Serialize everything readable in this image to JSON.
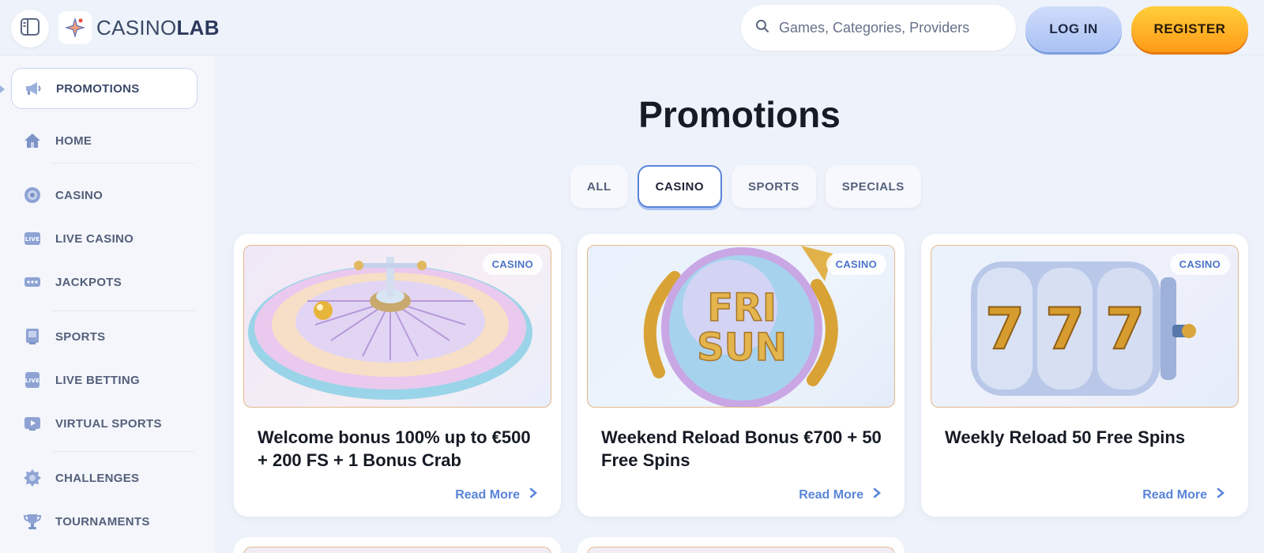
{
  "header": {
    "logo_text_regular": "CASINO",
    "logo_text_bold": "LAB",
    "search_placeholder": "Games, Categories, Providers",
    "login_label": "LOG IN",
    "register_label": "REGISTER"
  },
  "sidebar": {
    "items": [
      {
        "label": "PROMOTIONS",
        "icon": "megaphone-icon",
        "active": true
      },
      {
        "label": "HOME",
        "icon": "home-icon"
      },
      {
        "label": "CASINO",
        "icon": "casino-chip-icon"
      },
      {
        "label": "LIVE CASINO",
        "icon": "live-casino-icon"
      },
      {
        "label": "JACKPOTS",
        "icon": "jackpot-icon"
      },
      {
        "label": "SPORTS",
        "icon": "sports-icon"
      },
      {
        "label": "LIVE BETTING",
        "icon": "live-betting-icon"
      },
      {
        "label": "VIRTUAL SPORTS",
        "icon": "virtual-sports-icon"
      },
      {
        "label": "CHALLENGES",
        "icon": "challenges-icon"
      },
      {
        "label": "TOURNAMENTS",
        "icon": "trophy-icon"
      }
    ]
  },
  "main": {
    "title": "Promotions",
    "tabs": [
      {
        "label": "ALL"
      },
      {
        "label": "CASINO",
        "active": true
      },
      {
        "label": "SPORTS"
      },
      {
        "label": "SPECIALS"
      }
    ],
    "cards": [
      {
        "badge": "CASINO",
        "title": "Welcome bonus 100% up to €500 + 200 FS + 1 Bonus Crab",
        "link": "Read More",
        "image": "roulette-wheel"
      },
      {
        "badge": "CASINO",
        "title": "Weekend Reload Bonus €700 + 50 Free Spins",
        "link": "Read More",
        "image": "fri-sun-orb",
        "image_text_1": "FRI",
        "image_text_2": "SUN"
      },
      {
        "badge": "CASINO",
        "title": "Weekly Reload 50 Free Spins",
        "link": "Read More",
        "image": "slot-reels-777",
        "image_text": "777"
      }
    ]
  },
  "colors": {
    "accent_blue": "#5a84d9",
    "register_orange": "#ff9b17",
    "page_bg": "#eef2fa"
  }
}
